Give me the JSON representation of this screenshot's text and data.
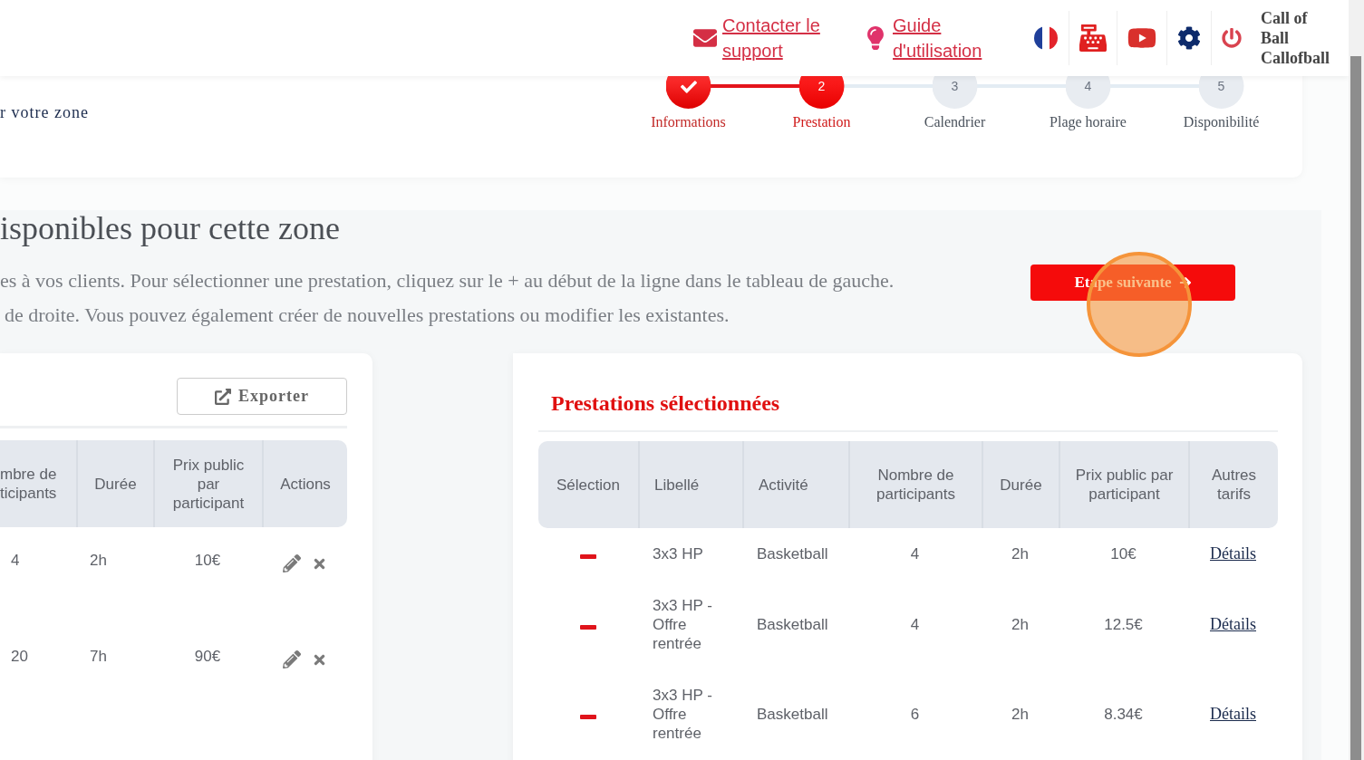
{
  "header": {
    "links": [
      {
        "kind": "mail",
        "label": "Contacter le support"
      },
      {
        "kind": "guide",
        "label": "Guide d'utilisation"
      }
    ],
    "user": "Call of Ball Callofball"
  },
  "zone_caption": "r votre zone",
  "steps": [
    {
      "label": "Informations",
      "completed": true,
      "selected": false
    },
    {
      "number": "2",
      "label": "Prestation",
      "completed": false,
      "selected": true
    },
    {
      "number": "3",
      "label": "Calendrier",
      "completed": false,
      "selected": false
    },
    {
      "number": "4",
      "label": "Plage horaire",
      "completed": false,
      "selected": false
    },
    {
      "number": "5",
      "label": "Disponibilité",
      "completed": false,
      "selected": false
    }
  ],
  "section": {
    "title": "isponibles pour cette zone",
    "description_lines": [
      "es à vos clients. Pour sélectionner une prestation, cliquez sur le + au début de la ligne dans le tableau de gauche.",
      "de droite. Vous pouvez également créer de nouvelles prestations ou modifier les existantes."
    ],
    "next_button": "Etape suivante"
  },
  "click_highlight": true,
  "available_table": {
    "export_button": "Exporter",
    "columns": [
      "mbre de ticipants",
      "Durée",
      "Prix public par participant",
      "Actions"
    ],
    "rows": [
      {
        "cells": [
          "4",
          "2h",
          "10€",
          ""
        ]
      },
      {
        "cells": [
          "20",
          "7h",
          "90€",
          ""
        ]
      }
    ]
  },
  "selected_panel": {
    "title": "Prestations sélectionnées",
    "columns": [
      "Sélection",
      "Libellé",
      "Activité",
      "Nombre de participants",
      "Durée",
      "Prix public par participant",
      "Autres tarifs"
    ],
    "rows": [
      {
        "cells": [
          "",
          "3x3 HP",
          "Basketball",
          "4",
          "2h",
          "10€",
          "Détails"
        ]
      },
      {
        "cells": [
          "",
          "3x3 HP - Offre rentrée",
          "Basketball",
          "4",
          "2h",
          "12.5€",
          "Détails"
        ]
      },
      {
        "cells": [
          "",
          "3x3 HP - Offre rentrée",
          "Basketball",
          "6",
          "2h",
          "8.34€",
          "Détails"
        ]
      }
    ]
  }
}
